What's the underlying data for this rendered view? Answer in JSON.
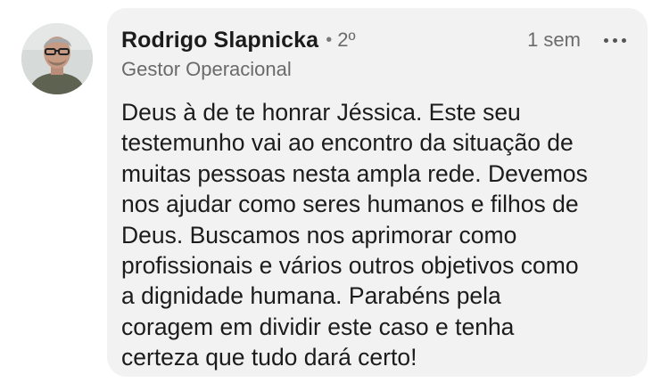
{
  "comment": {
    "author": {
      "name": "Rodrigo Slapnicka",
      "separator": "•",
      "degree": "2º",
      "headline": "Gestor Operacional",
      "avatar_icon": "profile-photo"
    },
    "timestamp": "1 sem",
    "menu_icon": "more-horizontal-icon",
    "body": "Deus à de te honrar Jéssica. Este seu\ntestemunho vai ao encontro da situação de\nmuitas pessoas nesta ampla rede. Devemos\nnos ajudar como seres humanos e filhos de\nDeus.  Buscamos nos aprimorar como\nprofissionais e vários outros objetivos como\na dignidade humana. Parabéns pela\ncoragem em dividir este caso e tenha\ncerteza que tudo dará certo!"
  },
  "colors": {
    "bubble_bg": "#f2f2f2",
    "text_primary": "#1c1c1c",
    "text_secondary": "#6b6b6b"
  }
}
